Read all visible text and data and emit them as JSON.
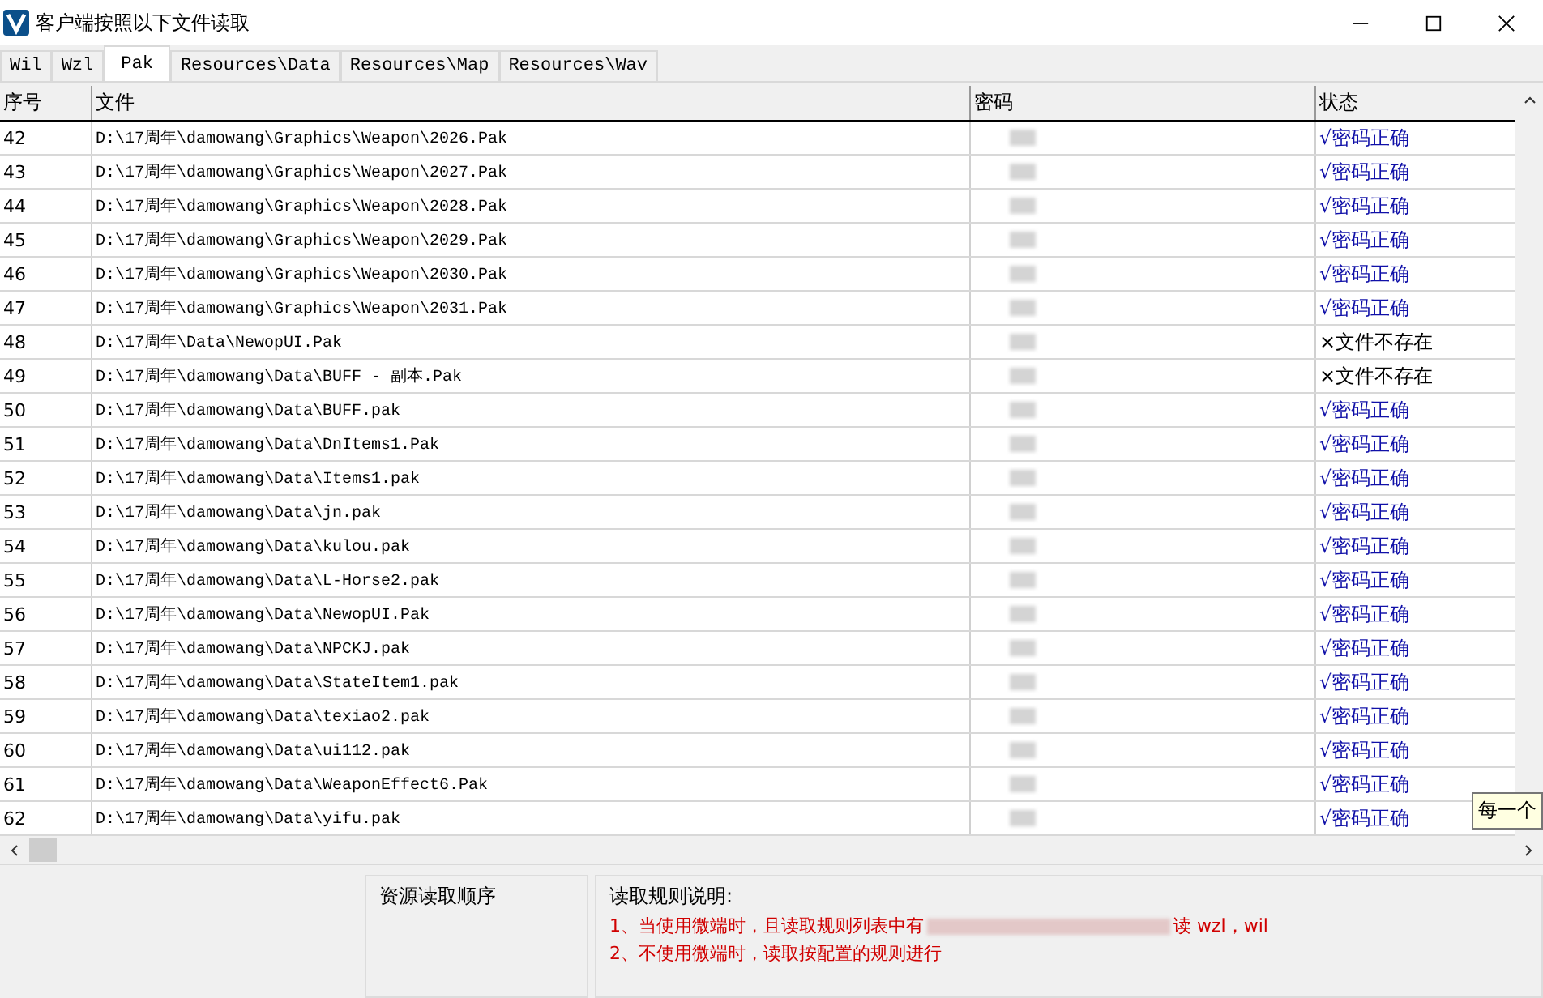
{
  "window": {
    "title": "客户端按照以下文件读取"
  },
  "tabs": [
    {
      "label": "Wil",
      "selected": false
    },
    {
      "label": "Wzl",
      "selected": false
    },
    {
      "label": "Pak",
      "selected": true
    },
    {
      "label": "Resources\\Data",
      "selected": false
    },
    {
      "label": "Resources\\Map",
      "selected": false
    },
    {
      "label": "Resources\\Wav",
      "selected": false
    }
  ],
  "table": {
    "columns": [
      "序号",
      "文件",
      "密码",
      "状态"
    ],
    "rows": [
      {
        "no": "42",
        "file": "D:\\17周年\\damowang\\Graphics\\Weapon\\2026.Pak",
        "kind": "ok",
        "status": "√密码正确"
      },
      {
        "no": "43",
        "file": "D:\\17周年\\damowang\\Graphics\\Weapon\\2027.Pak",
        "kind": "ok",
        "status": "√密码正确"
      },
      {
        "no": "44",
        "file": "D:\\17周年\\damowang\\Graphics\\Weapon\\2028.Pak",
        "kind": "ok",
        "status": "√密码正确"
      },
      {
        "no": "45",
        "file": "D:\\17周年\\damowang\\Graphics\\Weapon\\2029.Pak",
        "kind": "ok",
        "status": "√密码正确"
      },
      {
        "no": "46",
        "file": "D:\\17周年\\damowang\\Graphics\\Weapon\\2030.Pak",
        "kind": "ok",
        "status": "√密码正确"
      },
      {
        "no": "47",
        "file": "D:\\17周年\\damowang\\Graphics\\Weapon\\2031.Pak",
        "kind": "ok",
        "status": "√密码正确"
      },
      {
        "no": "48",
        "file": "D:\\17周年\\Data\\NewopUI.Pak",
        "kind": "missing",
        "status": "×文件不存在"
      },
      {
        "no": "49",
        "file": "D:\\17周年\\damowang\\Data\\BUFF - 副本.Pak",
        "kind": "missing",
        "status": "×文件不存在"
      },
      {
        "no": "50",
        "file": "D:\\17周年\\damowang\\Data\\BUFF.pak",
        "kind": "ok",
        "status": "√密码正确"
      },
      {
        "no": "51",
        "file": "D:\\17周年\\damowang\\Data\\DnItems1.Pak",
        "kind": "ok",
        "status": "√密码正确"
      },
      {
        "no": "52",
        "file": "D:\\17周年\\damowang\\Data\\Items1.pak",
        "kind": "ok",
        "status": "√密码正确"
      },
      {
        "no": "53",
        "file": "D:\\17周年\\damowang\\Data\\jn.pak",
        "kind": "ok",
        "status": "√密码正确"
      },
      {
        "no": "54",
        "file": "D:\\17周年\\damowang\\Data\\kulou.pak",
        "kind": "ok",
        "status": "√密码正确"
      },
      {
        "no": "55",
        "file": "D:\\17周年\\damowang\\Data\\L-Horse2.pak",
        "kind": "ok",
        "status": "√密码正确"
      },
      {
        "no": "56",
        "file": "D:\\17周年\\damowang\\Data\\NewopUI.Pak",
        "kind": "ok",
        "status": "√密码正确"
      },
      {
        "no": "57",
        "file": "D:\\17周年\\damowang\\Data\\NPCKJ.pak",
        "kind": "ok",
        "status": "√密码正确"
      },
      {
        "no": "58",
        "file": "D:\\17周年\\damowang\\Data\\StateItem1.pak",
        "kind": "ok",
        "status": "√密码正确"
      },
      {
        "no": "59",
        "file": "D:\\17周年\\damowang\\Data\\texiao2.pak",
        "kind": "ok",
        "status": "√密码正确"
      },
      {
        "no": "60",
        "file": "D:\\17周年\\damowang\\Data\\ui112.pak",
        "kind": "ok",
        "status": "√密码正确"
      },
      {
        "no": "61",
        "file": "D:\\17周年\\damowang\\Data\\WeaponEffect6.Pak",
        "kind": "ok",
        "status": "√密码正确"
      },
      {
        "no": "62",
        "file": "D:\\17周年\\damowang\\Data\\yifu.pak",
        "kind": "ok",
        "status": "√密码正确"
      }
    ]
  },
  "tooltip": "每一个",
  "order_group": {
    "title": "资源读取顺序"
  },
  "rules_group": {
    "title": "读取规则说明:",
    "lines": [
      {
        "start": "1、当使用微端时，且读取规则列表中有",
        "end": "读 wzl，wil"
      },
      {
        "start": "2、不使用微端时，读取按配置的规则进行"
      }
    ]
  }
}
